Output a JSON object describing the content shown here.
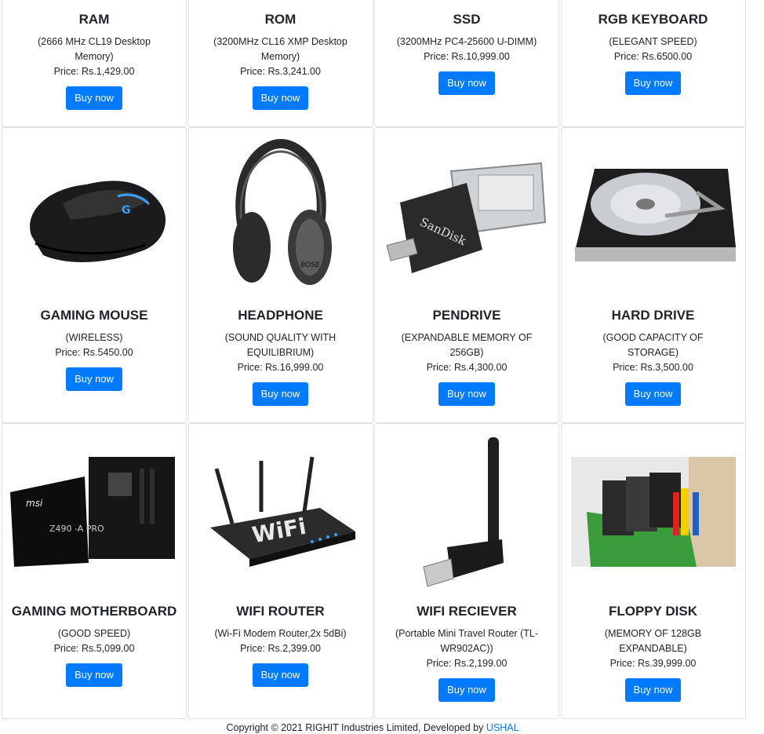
{
  "products": [
    {
      "name": "RAM",
      "desc": "(2666 MHz CL19 Desktop Memory)",
      "price": "Price: Rs.1,429.00",
      "button": "Buy now"
    },
    {
      "name": "ROM",
      "desc": "(3200MHz CL16 XMP Desktop Memory)",
      "price": "Price: Rs.3,241.00",
      "button": "Buy now"
    },
    {
      "name": "SSD",
      "desc": "(3200MHz PC4-25600 U-DIMM)",
      "price": "Price: Rs.10,999.00",
      "button": "Buy now"
    },
    {
      "name": "RGB KEYBOARD",
      "desc": "(ELEGANT SPEED)",
      "price": "Price: Rs.6500.00",
      "button": "Buy now"
    },
    {
      "name": "GAMING MOUSE",
      "desc": "(WIRELESS)",
      "price": "Price: Rs.5450.00",
      "button": "Buy now"
    },
    {
      "name": "HEADPHONE",
      "desc": "(SOUND QUALITY WITH EQUILIBRIUM)",
      "price": "Price: Rs.16,999.00",
      "button": "Buy now"
    },
    {
      "name": "PENDRIVE",
      "desc": "(EXPANDABLE MEMORY OF 256GB)",
      "price": "Price: Rs.4,300.00",
      "button": "Buy now"
    },
    {
      "name": "HARD DRIVE",
      "desc": "(GOOD CAPACITY OF STORAGE)",
      "price": "Price: Rs.3,500.00",
      "button": "Buy now"
    },
    {
      "name": "GAMING MOTHERBOARD",
      "desc": "(GOOD SPEED)",
      "price": "Price: Rs.5,099.00",
      "button": "Buy now"
    },
    {
      "name": "WIFI ROUTER",
      "desc": "(Wi-Fi Modem Router,2x 5dBi)",
      "price": "Price: Rs.2,399.00",
      "button": "Buy now"
    },
    {
      "name": "WIFI RECIEVER",
      "desc": "(Portable Mini Travel Router (TL-WR902AC))",
      "price": "Price: Rs.2,199.00",
      "button": "Buy now"
    },
    {
      "name": "FLOPPY DISK",
      "desc": "(MEMORY OF 128GB EXPANDABLE)",
      "price": "Price: Rs.39,999.00",
      "button": "Buy now"
    }
  ],
  "images": {
    "mouse_brand": "G",
    "headphone_brand": "BOSE",
    "pendrive_brand": "SanDisk",
    "board_brand": "msi",
    "board_model": "Z490 -A PRO",
    "router_text": "WiFi"
  },
  "footer": {
    "text": "Copyright © 2021 RIGHIT Industries Limited, Developed by ",
    "author": "USHAL"
  },
  "colors": {
    "accent": "#007bff",
    "border": "#dee2e6",
    "text": "#212529"
  }
}
